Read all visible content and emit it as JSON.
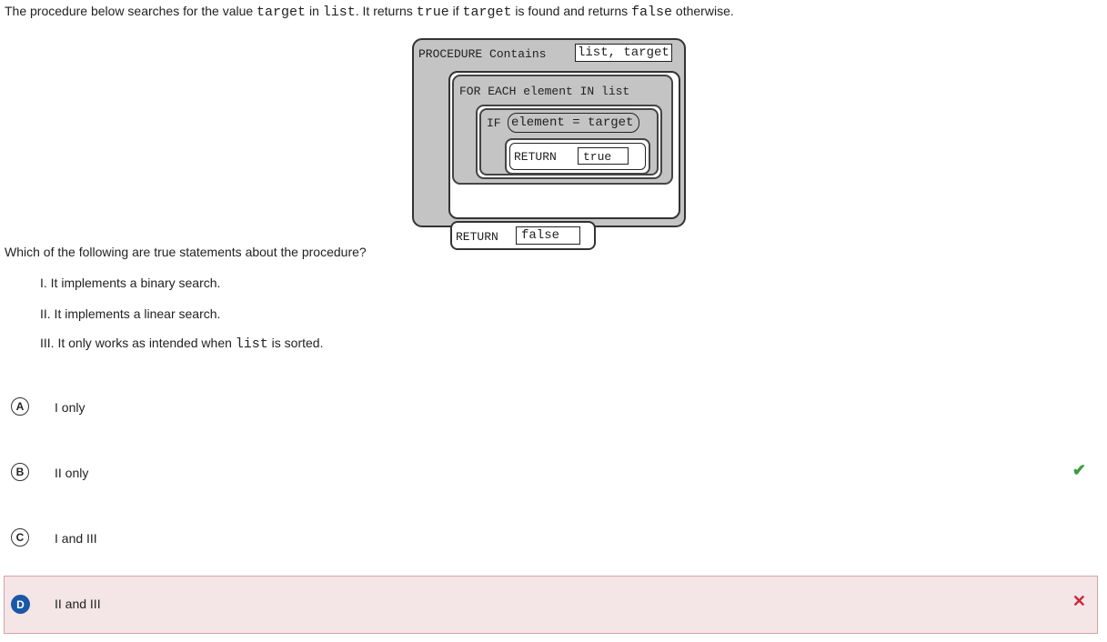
{
  "intro": {
    "t1": "The procedure below searches for the value ",
    "c1": "target",
    "t2": " in ",
    "c2": "list",
    "t3": ". It returns ",
    "c3": "true",
    "t4": " if ",
    "c4": "target",
    "t5": " is found and returns ",
    "c5": "false",
    "t6": " otherwise."
  },
  "code": {
    "procedure": "PROCEDURE Contains",
    "params": "list, target",
    "for_each": "FOR EACH element IN list",
    "if_kw": "IF",
    "condition": "element = target",
    "return_kw": "RETURN",
    "return_true": "true",
    "return_kw2": "RETURN",
    "return_false": "false"
  },
  "question": "Which of the following are true statements about the procedure?",
  "statements": {
    "s1": "I. It implements a binary search.",
    "s2": "II. It implements a linear search.",
    "s3a": "III. It only works as intended when ",
    "s3code": "list",
    "s3b": " is sorted."
  },
  "options": [
    {
      "letter": "A",
      "text": "I only"
    },
    {
      "letter": "B",
      "text": "II only",
      "mark": "✔"
    },
    {
      "letter": "C",
      "text": "I and III"
    },
    {
      "letter": "D",
      "text": "II and III",
      "mark": "✕"
    }
  ],
  "colors": {
    "correct": "#3c9a3c",
    "incorrect": "#c8283c",
    "selected_badge": "#1a57a6",
    "incorrect_bg": "#f4e5e6"
  }
}
